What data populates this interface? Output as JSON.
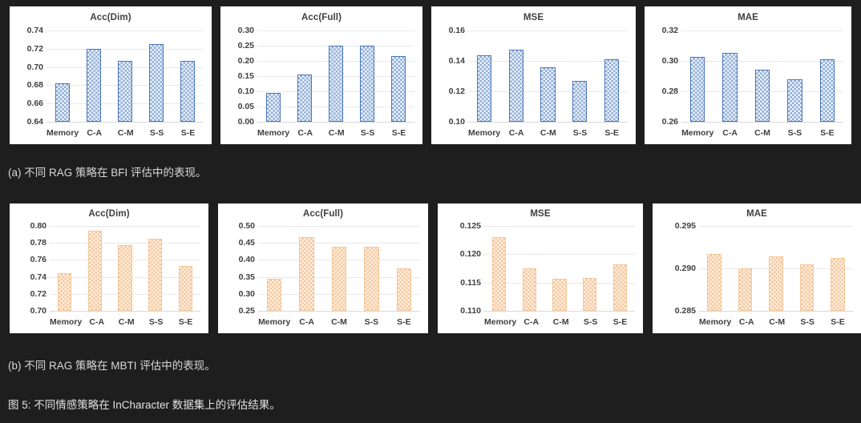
{
  "figure": {
    "caption_a": "(a) 不同 RAG 策略在 BFI 评估中的表现。",
    "caption_b": "(b) 不同 RAG 策略在 MBTI 评估中的表现。",
    "main_caption": "图 5: 不同情感策略在 InCharacter 数据集上的评估结果。"
  },
  "colors": {
    "blue_bar_fill": "#eef3fb",
    "blue_bar_pattern": "#8faed8",
    "blue_bar_border": "#4a76b8",
    "orange_bar_fill": "#fdf1e4",
    "orange_bar_pattern": "#f8c79c",
    "orange_bar_border": "#f3c79b",
    "panel_bg": "#ffffff",
    "page_bg": "#1e1e1e",
    "gridline": "#e8e8e8",
    "text": "#404040"
  },
  "chart_data": [
    {
      "id": "bfi-acc-dim",
      "type": "bar",
      "row": "a",
      "title": "Acc(Dim)",
      "xlabel": "",
      "ylabel": "",
      "categories": [
        "Memory",
        "C-A",
        "C-M",
        "S-S",
        "S-E"
      ],
      "values": [
        0.682,
        0.72,
        0.707,
        0.725,
        0.707
      ],
      "ylim": [
        0.64,
        0.74
      ],
      "yticks": [
        0.64,
        0.66,
        0.68,
        0.7,
        0.72,
        0.74
      ],
      "ytick_labels": [
        "0.64",
        "0.66",
        "0.68",
        "0.70",
        "0.72",
        "0.74"
      ],
      "series_color": "blue",
      "grid": true,
      "legend": "none"
    },
    {
      "id": "bfi-acc-full",
      "type": "bar",
      "row": "a",
      "title": "Acc(Full)",
      "xlabel": "",
      "ylabel": "",
      "categories": [
        "Memory",
        "C-A",
        "C-M",
        "S-S",
        "S-E"
      ],
      "values": [
        0.095,
        0.155,
        0.25,
        0.25,
        0.216
      ],
      "ylim": [
        0.0,
        0.3
      ],
      "yticks": [
        0.0,
        0.05,
        0.1,
        0.15,
        0.2,
        0.25,
        0.3
      ],
      "ytick_labels": [
        "0.00",
        "0.05",
        "0.10",
        "0.15",
        "0.20",
        "0.25",
        "0.30"
      ],
      "series_color": "blue",
      "grid": true,
      "legend": "none"
    },
    {
      "id": "bfi-mse",
      "type": "bar",
      "row": "a",
      "title": "MSE",
      "xlabel": "",
      "ylabel": "",
      "categories": [
        "Memory",
        "C-A",
        "C-M",
        "S-S",
        "S-E"
      ],
      "values": [
        0.1435,
        0.1473,
        0.1357,
        0.1268,
        0.1413
      ],
      "ylim": [
        0.1,
        0.16
      ],
      "yticks": [
        0.1,
        0.12,
        0.14,
        0.16
      ],
      "ytick_labels": [
        "0.10",
        "0.12",
        "0.14",
        "0.16"
      ],
      "series_color": "blue",
      "grid": true,
      "legend": "none"
    },
    {
      "id": "bfi-mae",
      "type": "bar",
      "row": "a",
      "title": "MAE",
      "xlabel": "",
      "ylabel": "",
      "categories": [
        "Memory",
        "C-A",
        "C-M",
        "S-S",
        "S-E"
      ],
      "values": [
        0.3027,
        0.3053,
        0.294,
        0.2878,
        0.301
      ],
      "ylim": [
        0.26,
        0.32
      ],
      "yticks": [
        0.26,
        0.28,
        0.3,
        0.32
      ],
      "ytick_labels": [
        "0.26",
        "0.28",
        "0.30",
        "0.32"
      ],
      "series_color": "blue",
      "grid": true,
      "legend": "none"
    },
    {
      "id": "mbti-acc-dim",
      "type": "bar",
      "row": "b",
      "title": "Acc(Dim)",
      "xlabel": "",
      "ylabel": "",
      "categories": [
        "Memory",
        "C-A",
        "C-M",
        "S-S",
        "S-E"
      ],
      "values": [
        0.744,
        0.794,
        0.777,
        0.785,
        0.753
      ],
      "ylim": [
        0.7,
        0.8
      ],
      "yticks": [
        0.7,
        0.72,
        0.74,
        0.76,
        0.78,
        0.8
      ],
      "ytick_labels": [
        "0.70",
        "0.72",
        "0.74",
        "0.76",
        "0.78",
        "0.80"
      ],
      "series_color": "orange",
      "grid": true,
      "legend": "none"
    },
    {
      "id": "mbti-acc-full",
      "type": "bar",
      "row": "b",
      "title": "Acc(Full)",
      "xlabel": "",
      "ylabel": "",
      "categories": [
        "Memory",
        "C-A",
        "C-M",
        "S-S",
        "S-E"
      ],
      "values": [
        0.344,
        0.468,
        0.438,
        0.438,
        0.376
      ],
      "ylim": [
        0.25,
        0.5
      ],
      "yticks": [
        0.25,
        0.3,
        0.35,
        0.4,
        0.45,
        0.5
      ],
      "ytick_labels": [
        "0.25",
        "0.30",
        "0.35",
        "0.40",
        "0.45",
        "0.50"
      ],
      "series_color": "orange",
      "grid": true,
      "legend": "none"
    },
    {
      "id": "mbti-mse",
      "type": "bar",
      "row": "b",
      "title": "MSE",
      "xlabel": "",
      "ylabel": "",
      "categories": [
        "Memory",
        "C-A",
        "C-M",
        "S-S",
        "S-E"
      ],
      "values": [
        0.123,
        0.1175,
        0.1156,
        0.1158,
        0.1182
      ],
      "ylim": [
        0.11,
        0.125
      ],
      "yticks": [
        0.11,
        0.115,
        0.12,
        0.125
      ],
      "ytick_labels": [
        "0.110",
        "0.115",
        "0.120",
        "0.125"
      ],
      "series_color": "orange",
      "grid": true,
      "legend": "none"
    },
    {
      "id": "mbti-mae",
      "type": "bar",
      "row": "b",
      "title": "MAE",
      "xlabel": "",
      "ylabel": "",
      "categories": [
        "Memory",
        "C-A",
        "C-M",
        "S-S",
        "S-E"
      ],
      "values": [
        0.2917,
        0.29,
        0.2914,
        0.2905,
        0.2912
      ],
      "ylim": [
        0.285,
        0.295
      ],
      "yticks": [
        0.285,
        0.29,
        0.295
      ],
      "ytick_labels": [
        "0.285",
        "0.290",
        "0.295"
      ],
      "series_color": "orange",
      "grid": true,
      "legend": "none"
    }
  ]
}
